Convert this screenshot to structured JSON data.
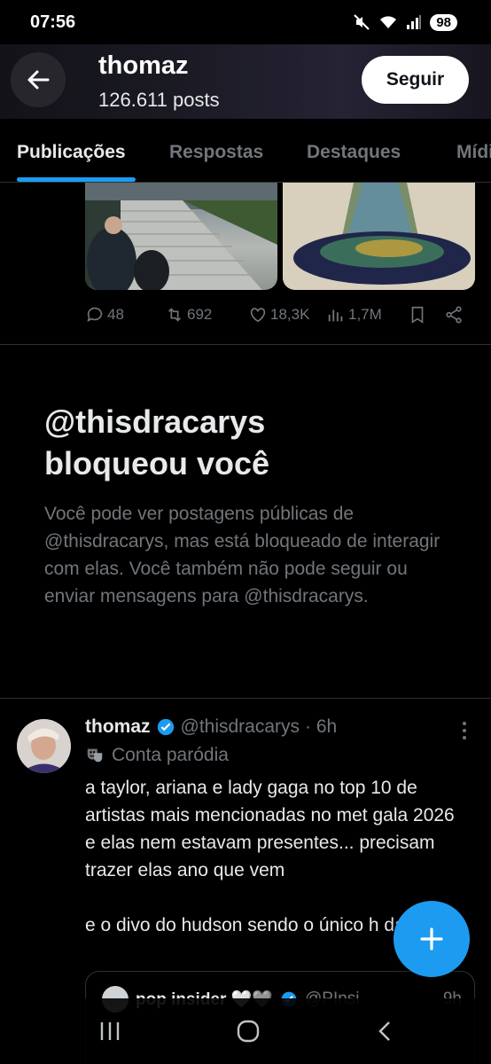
{
  "status_bar": {
    "time": "07:56",
    "battery": "98",
    "icons": [
      "mute-icon",
      "wifi-icon",
      "signal-icon",
      "battery-icon"
    ]
  },
  "header": {
    "title": "thomaz",
    "subtitle": "126.611 posts",
    "follow_label": "Seguir"
  },
  "tabs": [
    {
      "label": "Publicações",
      "active": true
    },
    {
      "label": "Respostas",
      "active": false
    },
    {
      "label": "Destaques",
      "active": false
    },
    {
      "label": "Mídia",
      "active": false
    }
  ],
  "previous_post": {
    "replies": "48",
    "reposts": "692",
    "likes": "18,3K",
    "views": "1,7M"
  },
  "blocked_notice": {
    "title_line1": "@thisdracarys",
    "title_line2": "bloqueou você",
    "body": "Você pode ver postagens públicas de @thisdracarys, mas está bloqueado de interagir com elas. Você também não pode seguir ou enviar mensagens para @thisdracarys."
  },
  "tweet": {
    "name": "thomaz",
    "handle": "@thisdracarys",
    "time": "· 6h",
    "parody_label": "Conta paródia",
    "text": "a taylor, ariana e lady gaga no top 10 de artistas mais mencionadas no met gala 2026 e elas nem estavam presentes... precisam trazer elas ano que vem\n\ne o divo do hudson sendo o único h da lista"
  },
  "quoted_tweet": {
    "name": "pop insider 🤍🩶",
    "handle": "@PInsi",
    "time": "9h"
  },
  "colors": {
    "accent": "#1d9bf0",
    "background": "#000000",
    "secondary_text": "#71767b",
    "primary_text": "#e7e9ea"
  }
}
